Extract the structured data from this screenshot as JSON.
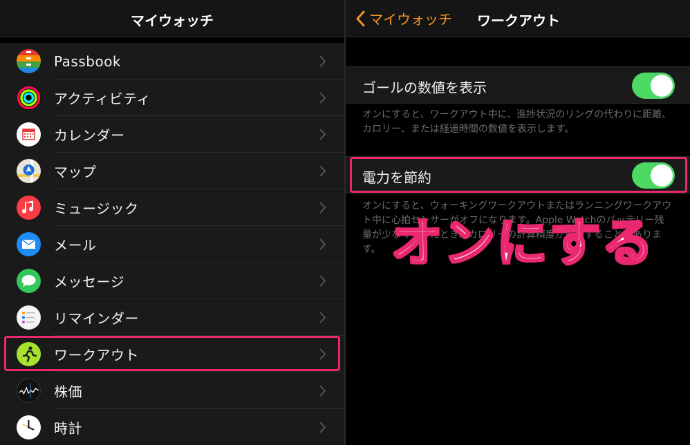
{
  "left": {
    "title": "マイウォッチ",
    "items": [
      {
        "label": "Passbook",
        "icon": "passbook-icon"
      },
      {
        "label": "アクティビティ",
        "icon": "activity-icon"
      },
      {
        "label": "カレンダー",
        "icon": "calendar-icon"
      },
      {
        "label": "マップ",
        "icon": "maps-icon"
      },
      {
        "label": "ミュージック",
        "icon": "music-icon"
      },
      {
        "label": "メール",
        "icon": "mail-icon"
      },
      {
        "label": "メッセージ",
        "icon": "messages-icon"
      },
      {
        "label": "リマインダー",
        "icon": "reminders-icon"
      },
      {
        "label": "ワークアウト",
        "icon": "workout-icon"
      },
      {
        "label": "株価",
        "icon": "stocks-icon"
      },
      {
        "label": "時計",
        "icon": "clock-icon"
      }
    ]
  },
  "right": {
    "back_label": "マイウォッチ",
    "title": "ワークアウト",
    "goal_label": "ゴールの数値を表示",
    "goal_on": true,
    "goal_note": "オンにすると、ワークアウト中に、進捗状況のリングの代わりに距離、カロリー、または経過時間の数値を表示します。",
    "power_label": "電力を節約",
    "power_on": true,
    "power_note": "オンにすると、ウォーキングワークアウトまたはランニングワークアウト中に心拍センサーがオフになります。Apple Watchのバッテリー残量が少なくなったとき、カロリーの計算精度が低下することがあります。"
  },
  "annotation": {
    "text": "オンにする"
  },
  "colors": {
    "accent": "#f7931e",
    "toggle_on": "#4cd964",
    "highlight": "#e9286f"
  }
}
